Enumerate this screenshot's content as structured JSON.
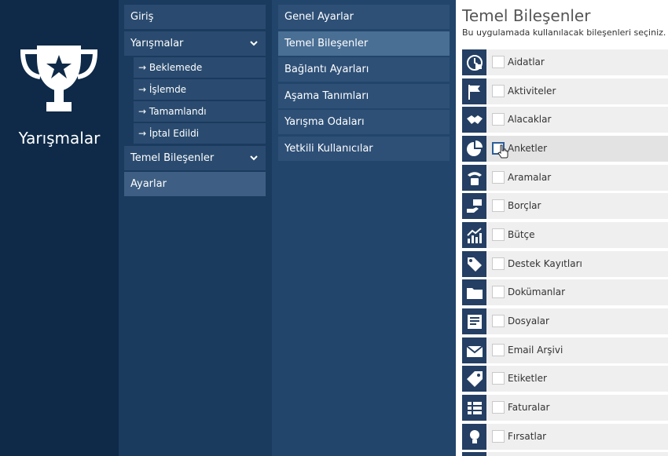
{
  "brand": {
    "title": "Yarışmalar",
    "icon": "trophy-icon"
  },
  "nav": {
    "giris": "Giriş",
    "yarismalar": "Yarışmalar",
    "sub": [
      "→ Beklemede",
      "→ İşlemde",
      "→ Tamamlandı",
      "→ İptal Edildi"
    ],
    "temel": "Temel Bileşenler",
    "ayarlar": "Ayarlar"
  },
  "settings": {
    "items": [
      "Genel Ayarlar",
      "Temel Bileşenler",
      "Bağlantı Ayarları",
      "Aşama Tanımları",
      "Yarışma Odaları",
      "Yetkili Kullanıcılar"
    ],
    "active_index": 1
  },
  "main": {
    "title": "Temel Bileşenler",
    "subtitle": "Bu uygulamada kullanılacak bileşenleri seçiniz.",
    "components": [
      {
        "label": "Aidatlar",
        "icon": "dues-clock-icon"
      },
      {
        "label": "Aktiviteler",
        "icon": "flag-icon"
      },
      {
        "label": "Alacaklar",
        "icon": "handshake-icon"
      },
      {
        "label": "Anketler",
        "icon": "pie-chart-icon"
      },
      {
        "label": "Aramalar",
        "icon": "phone-icon"
      },
      {
        "label": "Borçlar",
        "icon": "money-hand-icon"
      },
      {
        "label": "Bütçe",
        "icon": "growth-chart-icon"
      },
      {
        "label": "Destek Kayıtları",
        "icon": "tags-icon"
      },
      {
        "label": "Dokümanlar",
        "icon": "folder-icon"
      },
      {
        "label": "Dosyalar",
        "icon": "newspaper-icon"
      },
      {
        "label": "Email Arşivi",
        "icon": "email-icon"
      },
      {
        "label": "Etiketler",
        "icon": "tag-icon"
      },
      {
        "label": "Faturalar",
        "icon": "list-icon"
      },
      {
        "label": "Fırsatlar",
        "icon": "lightbulb-icon"
      }
    ],
    "hover_index": 3
  },
  "colors": {
    "brand_bg": "#0e2a48",
    "nav_bg": "#1a3a5e",
    "settings_bg": "#21456b",
    "icon_tile": "#243f63"
  }
}
